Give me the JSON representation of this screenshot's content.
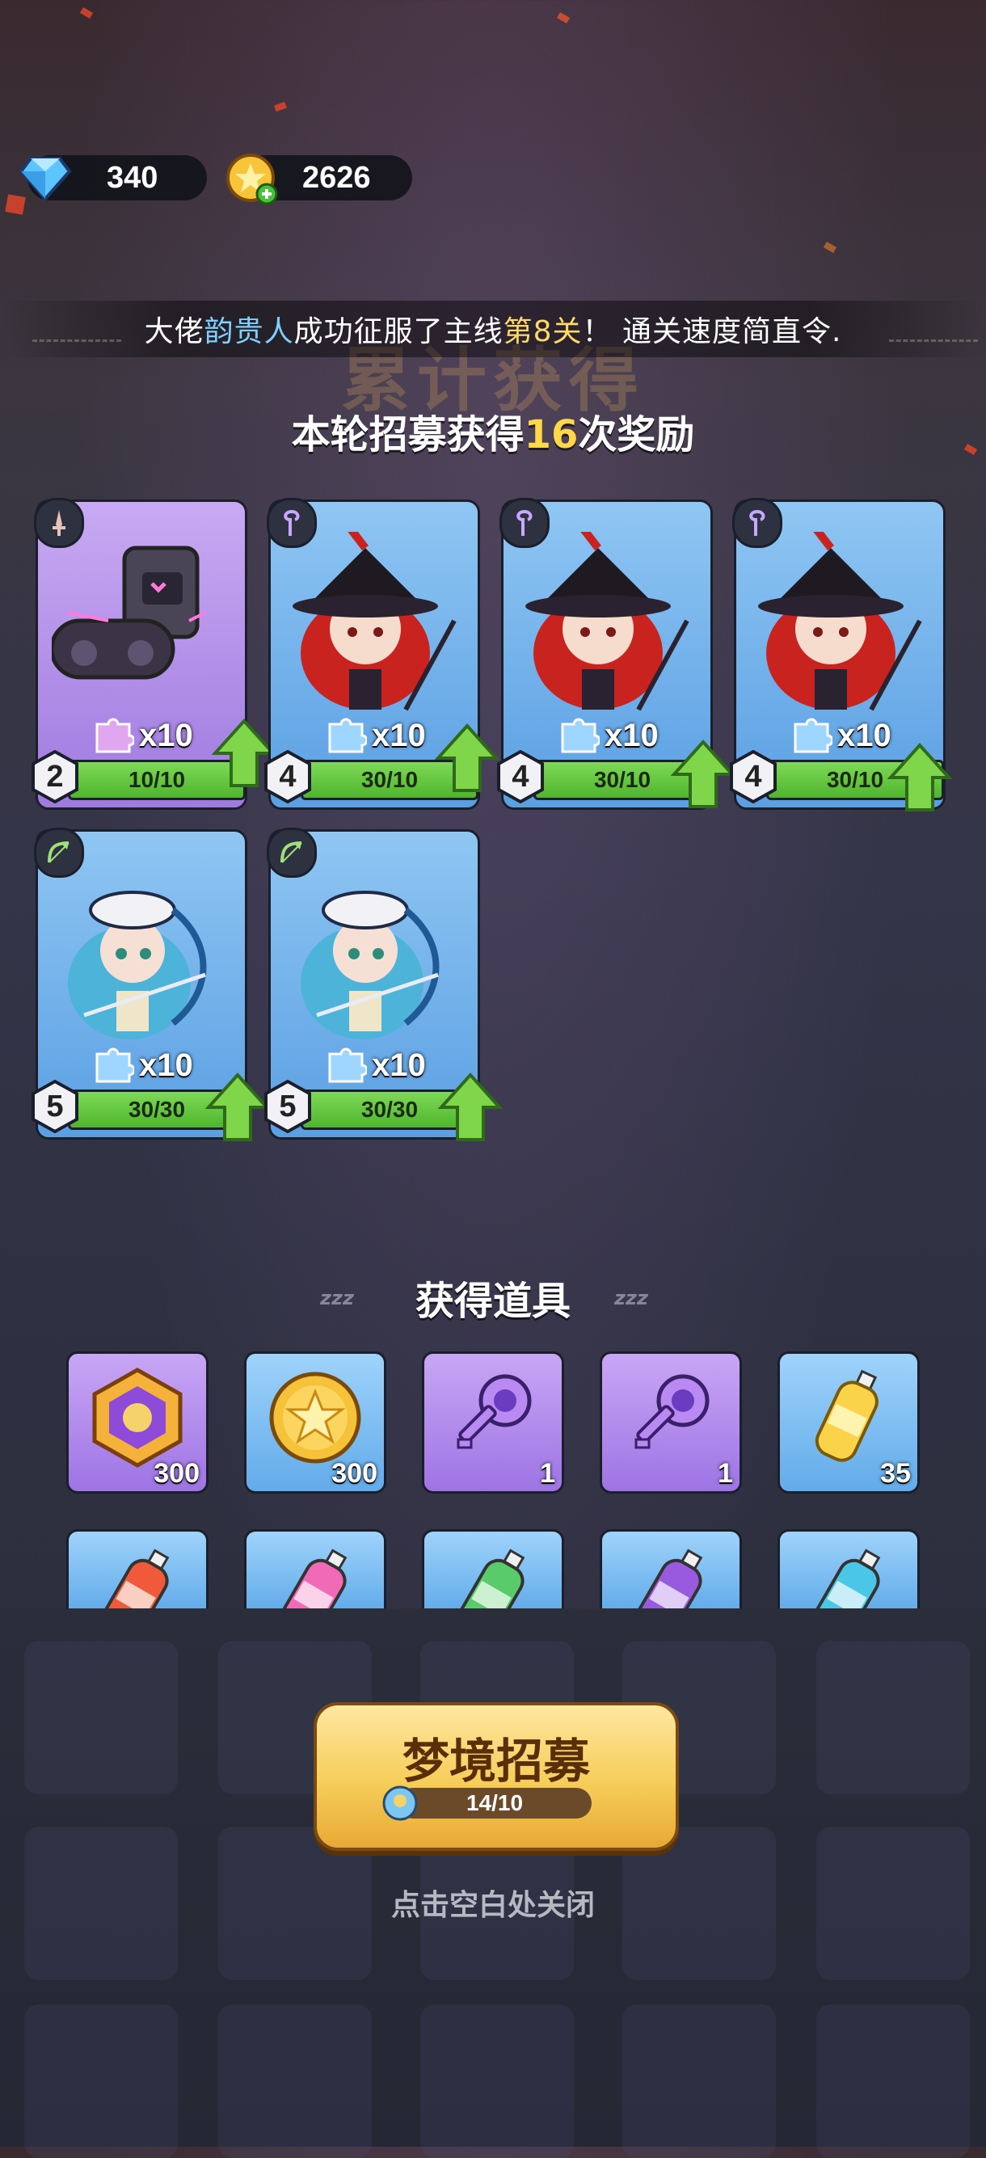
{
  "currency": {
    "gems": "340",
    "coins": "2626"
  },
  "marquee": {
    "prefix": "大佬",
    "player": "韵贵人",
    "middle": "成功征服了主线",
    "level": "第8关",
    "suffix": "！ 通关速度简直令."
  },
  "banner": {
    "ghost_title": "累计获得",
    "round_prefix": "本轮招募获得",
    "round_count": "16",
    "round_suffix": "次奖励"
  },
  "heroes": [
    {
      "class_icon": "sword-icon",
      "shards": "x10",
      "level": "2",
      "progress": "10/10",
      "color": "purple"
    },
    {
      "class_icon": "staff-icon",
      "shards": "x10",
      "level": "4",
      "progress": "30/10",
      "color": "blue"
    },
    {
      "class_icon": "staff-icon",
      "shards": "x10",
      "level": "4",
      "progress": "30/10",
      "color": "blue"
    },
    {
      "class_icon": "staff-icon",
      "shards": "x10",
      "level": "4",
      "progress": "30/10",
      "color": "blue"
    },
    {
      "class_icon": "bow-icon",
      "shards": "x10",
      "level": "5",
      "progress": "30/30",
      "color": "blue"
    },
    {
      "class_icon": "bow-icon",
      "shards": "x10",
      "level": "5",
      "progress": "30/30",
      "color": "blue"
    }
  ],
  "items_title": "获得道具",
  "items": [
    {
      "icon": "hexagon-medal-icon",
      "count": "300",
      "color": "purple"
    },
    {
      "icon": "star-coin-icon",
      "count": "300",
      "color": "blue"
    },
    {
      "icon": "purple-key-icon",
      "count": "1",
      "color": "purple"
    },
    {
      "icon": "purple-key-icon",
      "count": "1",
      "color": "purple"
    },
    {
      "icon": "yellow-bottle-icon",
      "count": "35",
      "color": "blue"
    }
  ],
  "items_row2": [
    {
      "icon": "red-bottle-icon"
    },
    {
      "icon": "pink-bottle-icon"
    },
    {
      "icon": "green-bottle-icon"
    },
    {
      "icon": "purple-bottle-icon"
    },
    {
      "icon": "cyan-bottle-icon"
    }
  ],
  "recruit": {
    "label": "梦境招募",
    "progress": "14/10"
  },
  "close_hint": "点击空白处关闭"
}
